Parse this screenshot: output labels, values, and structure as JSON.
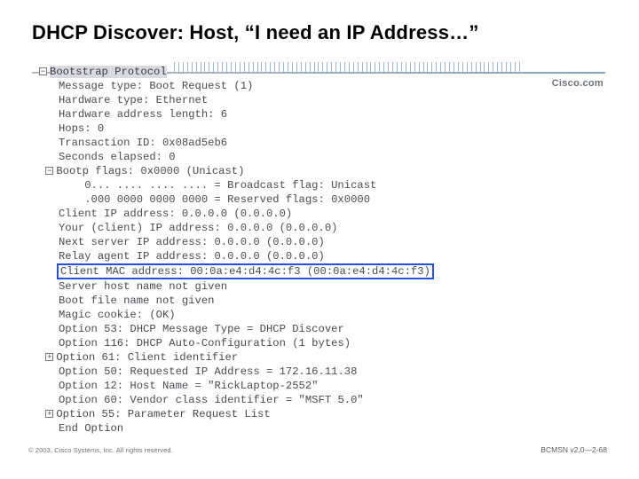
{
  "slide": {
    "title": "DHCP Discover: Host, “I need an IP Address…”"
  },
  "brand": {
    "logo_text": "Cisco.com"
  },
  "packet": {
    "header": "Bootstrap Protocol",
    "l1": "Message type: Boot Request (1)",
    "l2": "Hardware type: Ethernet",
    "l3": "Hardware address length: 6",
    "l4": "Hops: 0",
    "l5": "Transaction ID: 0x08ad5eb6",
    "l6": "Seconds elapsed: 0",
    "l7": "Bootp flags: 0x0000 (Unicast)",
    "l7a": "0... .... .... .... = Broadcast flag: Unicast",
    "l7b": ".000 0000 0000 0000 = Reserved flags: 0x0000",
    "l8": "Client IP address: 0.0.0.0 (0.0.0.0)",
    "l9": "Your (client) IP address: 0.0.0.0 (0.0.0.0)",
    "l10": "Next server IP address: 0.0.0.0 (0.0.0.0)",
    "l11": "Relay agent IP address: 0.0.0.0 (0.0.0.0)",
    "l12": "Client MAC address: 00:0a:e4:d4:4c:f3 (00:0a:e4:d4:4c:f3)",
    "l13": "Server host name not given",
    "l14": "Boot file name not given",
    "l15": "Magic cookie: (OK)",
    "l16": "Option 53: DHCP Message Type = DHCP Discover",
    "l17": "Option 116: DHCP Auto-Configuration (1 bytes)",
    "l18": "Option 61: Client identifier",
    "l19": "Option 50: Requested IP Address = 172.16.11.38",
    "l20": "Option 12: Host Name = \"RickLaptop-2552\"",
    "l21": "Option 60: Vendor class identifier = \"MSFT 5.0\"",
    "l22": "Option 55: Parameter Request List",
    "l23": "End Option"
  },
  "footer": {
    "left": "© 2003, Cisco Systems, Inc. All rights reserved.",
    "right": "BCMSN v2.0—2-68"
  },
  "chart_data": {
    "type": "table",
    "title": "DHCP Discover decoded packet (Bootstrap Protocol)",
    "fields": [
      [
        "Message type",
        "Boot Request (1)"
      ],
      [
        "Hardware type",
        "Ethernet"
      ],
      [
        "Hardware address length",
        "6"
      ],
      [
        "Hops",
        "0"
      ],
      [
        "Transaction ID",
        "0x08ad5eb6"
      ],
      [
        "Seconds elapsed",
        "0"
      ],
      [
        "Bootp flags",
        "0x0000 (Unicast)"
      ],
      [
        "Broadcast flag",
        "Unicast"
      ],
      [
        "Reserved flags",
        "0x0000"
      ],
      [
        "Client IP address",
        "0.0.0.0"
      ],
      [
        "Your (client) IP address",
        "0.0.0.0"
      ],
      [
        "Next server IP address",
        "0.0.0.0"
      ],
      [
        "Relay agent IP address",
        "0.0.0.0"
      ],
      [
        "Client MAC address",
        "00:0a:e4:d4:4c:f3"
      ],
      [
        "Server host name",
        "not given"
      ],
      [
        "Boot file name",
        "not given"
      ],
      [
        "Magic cookie",
        "(OK)"
      ],
      [
        "Option 53",
        "DHCP Message Type = DHCP Discover"
      ],
      [
        "Option 116",
        "DHCP Auto-Configuration (1 bytes)"
      ],
      [
        "Option 61",
        "Client identifier"
      ],
      [
        "Option 50",
        "Requested IP Address = 172.16.11.38"
      ],
      [
        "Option 12",
        "Host Name = \"RickLaptop-2552\""
      ],
      [
        "Option 60",
        "Vendor class identifier = \"MSFT 5.0\""
      ],
      [
        "Option 55",
        "Parameter Request List"
      ],
      [
        "End Option",
        ""
      ]
    ]
  }
}
